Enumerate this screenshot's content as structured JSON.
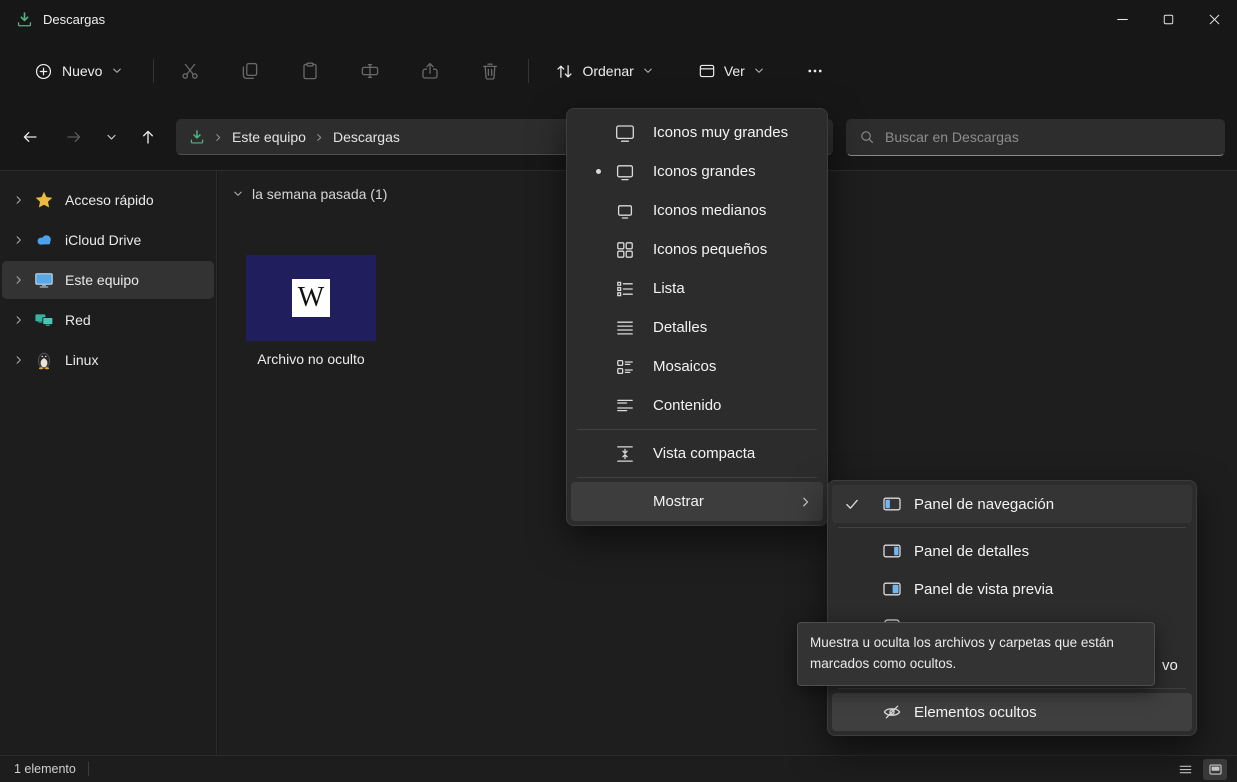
{
  "titlebar": {
    "title": "Descargas"
  },
  "toolbar": {
    "new_label": "Nuevo",
    "sort_label": "Ordenar",
    "view_label": "Ver",
    "icons": [
      "plus-circle",
      "cut",
      "copy",
      "paste",
      "rename",
      "share",
      "delete",
      "sort-arrows",
      "view-window",
      "more-options"
    ]
  },
  "addressbar": {
    "icon": "downloads-folder",
    "crumb_root": "Este equipo",
    "crumb_current": "Descargas"
  },
  "search": {
    "icon": "magnifier",
    "placeholder": "Buscar en Descargas"
  },
  "sidebar": {
    "items": [
      {
        "label": "Acceso rápido",
        "icon": "star"
      },
      {
        "label": "iCloud Drive",
        "icon": "cloud"
      },
      {
        "label": "Este equipo",
        "icon": "computer",
        "selected": true
      },
      {
        "label": "Red",
        "icon": "network"
      },
      {
        "label": "Linux",
        "icon": "penguin"
      }
    ]
  },
  "content": {
    "group_header": "la semana pasada (1)",
    "files": [
      {
        "name": "Archivo no oculto",
        "thumb_letter": "W",
        "thumb_color": "#211e5e"
      }
    ]
  },
  "view_menu": {
    "items": [
      {
        "label": "Iconos muy grandes",
        "icon": "display-xl"
      },
      {
        "label": "Iconos grandes",
        "icon": "display-lg",
        "selected": true
      },
      {
        "label": "Iconos medianos",
        "icon": "display-md"
      },
      {
        "label": "Iconos pequeños",
        "icon": "grid-small"
      },
      {
        "label": "Lista",
        "icon": "list"
      },
      {
        "label": "Detalles",
        "icon": "details-lines"
      },
      {
        "label": "Mosaicos",
        "icon": "tiles"
      },
      {
        "label": "Contenido",
        "icon": "content-rows"
      },
      {
        "label": "Vista compacta",
        "icon": "compact"
      },
      {
        "label": "Mostrar",
        "has_submenu": true,
        "highlighted": true
      }
    ]
  },
  "show_submenu": {
    "items": [
      {
        "label": "Panel de navegación",
        "icon": "panel-left",
        "checked": true
      },
      {
        "label": "Panel de detalles",
        "icon": "panel-right"
      },
      {
        "label": "Panel de vista previa",
        "icon": "panel-preview"
      },
      {
        "label": "",
        "icon": "checkbox",
        "occluded_by_tooltip": true
      },
      {
        "label": "vo",
        "occluded_by_tooltip": true
      },
      {
        "label": "Elementos ocultos",
        "icon": "eye-hidden",
        "highlighted": true
      }
    ]
  },
  "tooltip": {
    "text": "Muestra u oculta los archivos y carpetas que están marcados como ocultos."
  },
  "statusbar": {
    "count": "1 elemento",
    "view_toggles": [
      "details-view",
      "thumbnail-view"
    ]
  },
  "colors": {
    "menu_bg": "#2c2c2c",
    "highlight": "#3d3d3d",
    "thumbnail_bg": "#211e5e",
    "star": "#edba3f",
    "panel_icon_blue": "#74b6ef"
  }
}
